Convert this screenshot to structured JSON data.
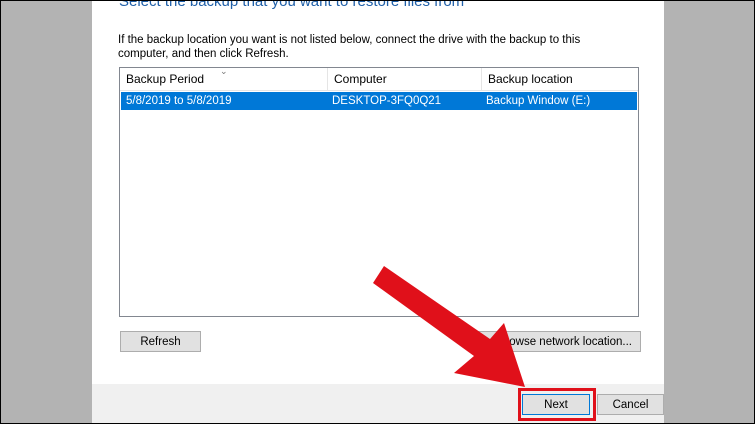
{
  "dialog": {
    "heading": "Select the backup that you want to restore files from",
    "instruction": "If the backup location you want is not listed below, connect the drive with the backup to this computer, and then click Refresh."
  },
  "backup_list": {
    "columns": [
      "Backup Period",
      "Computer",
      "Backup location"
    ],
    "rows": [
      {
        "period": "5/8/2019 to 5/8/2019",
        "computer": "DESKTOP-3FQ0Q21",
        "location": "Backup Window (E:)",
        "selected": true
      }
    ]
  },
  "buttons": {
    "refresh": "Refresh",
    "browse": "Browse network location...",
    "next": "Next",
    "cancel": "Cancel"
  },
  "colors": {
    "selection": "#0078d7",
    "heading": "#1f5fa8",
    "annotation": "#e0101a"
  },
  "icons": {
    "sort": "sort-chevron-down-icon",
    "annotation": "red-arrow-icon"
  }
}
